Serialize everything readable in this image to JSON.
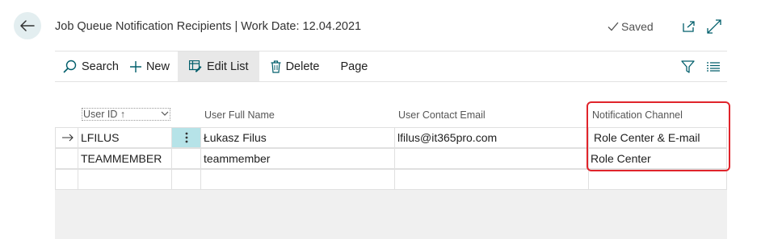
{
  "header": {
    "title": "Job Queue Notification Recipients | Work Date: 12.04.2021",
    "saved_label": "Saved"
  },
  "toolbar": {
    "search_label": "Search",
    "new_label": "New",
    "edit_list_label": "Edit List",
    "delete_label": "Delete",
    "page_label": "Page"
  },
  "table": {
    "columns": [
      "User ID ↑",
      "User Full Name",
      "User Contact Email",
      "Notification Channel"
    ],
    "rows": [
      {
        "user_id": "LFILUS",
        "full_name": "Łukasz Filus",
        "email": "lfilus@it365pro.com",
        "channel": "Role Center & E-mail"
      },
      {
        "user_id": "TEAMMEMBER",
        "full_name": "teammember",
        "email": "",
        "channel": "Role Center"
      }
    ]
  },
  "colors": {
    "accent": "#005e6b",
    "highlight_border": "#e0242b",
    "active_cell": "#b6e3e8",
    "back_button_bg": "#e3eef0"
  }
}
